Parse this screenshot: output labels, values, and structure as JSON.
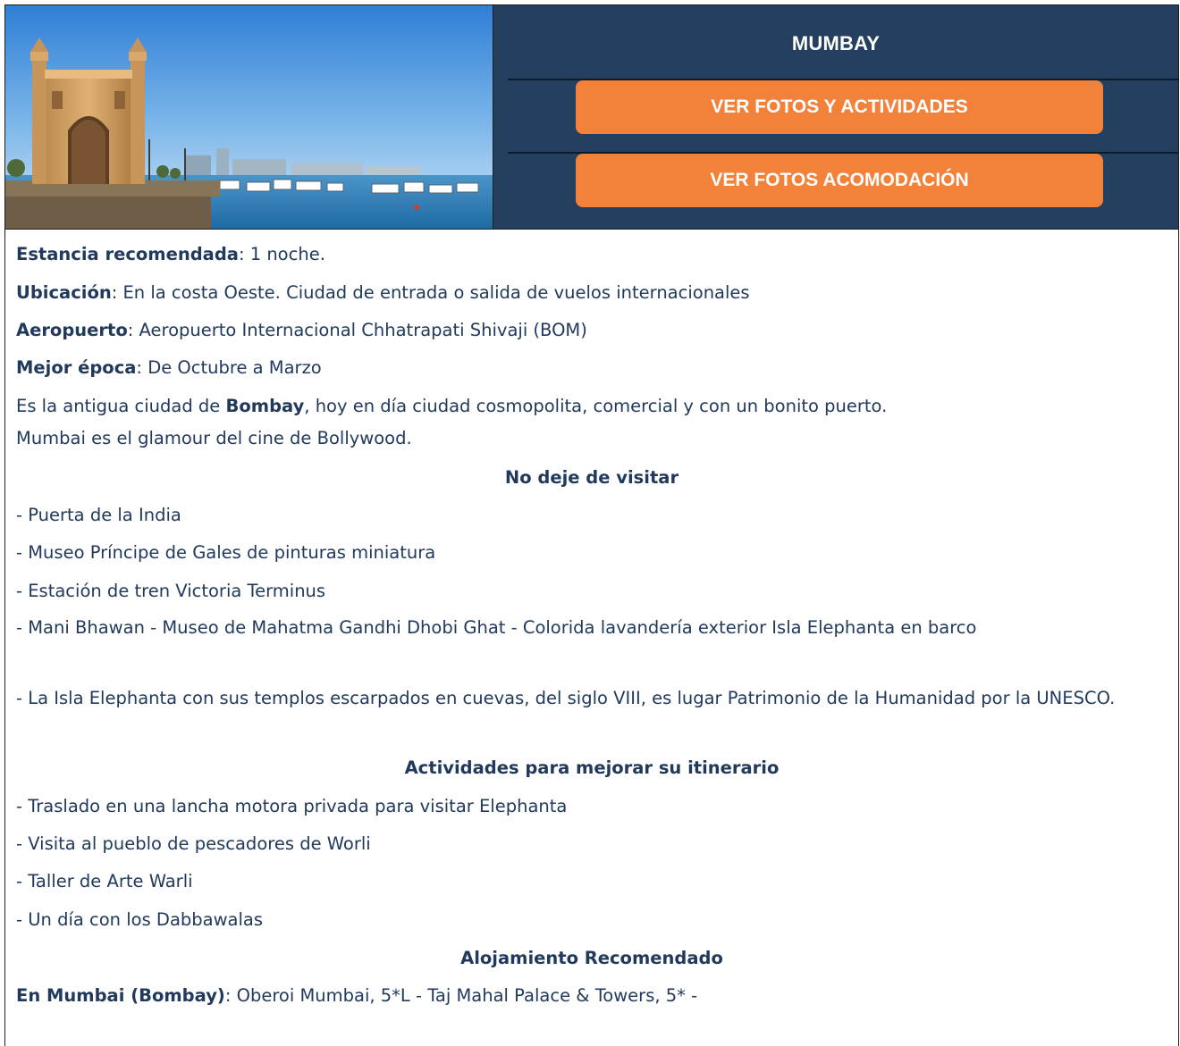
{
  "header": {
    "city": "MUMBAY",
    "buttons": {
      "activities": "VER FOTOS Y ACTIVIDADES",
      "accommodation": "VER FOTOS ACOMODACIÓN"
    }
  },
  "info": {
    "stay_label": "Estancia recomendada",
    "stay_value": ": 1 noche.",
    "location_label": "Ubicación",
    "location_value": ": En la costa Oeste. Ciudad de entrada o salida de vuelos internacionales",
    "airport_label": "Aeropuerto",
    "airport_value": ": Aeropuerto Internacional Chhatrapati Shivaji (BOM)",
    "season_label": "Mejor época",
    "season_value": ": De Octubre a Marzo",
    "desc_prefix": "Es la antigua ciudad de ",
    "desc_bold": "Bombay",
    "desc_suffix": ", hoy en día ciudad cosmopolita, comercial y con un bonito puerto.",
    "desc_line2": "Mumbai es el glamour del cine de Bollywood."
  },
  "visit": {
    "heading": "No deje de visitar",
    "items": [
      "- Puerta de la India",
      "- Museo Príncipe de Gales de pinturas miniatura",
      "- Estación de tren Victoria Terminus",
      "- Mani Bhawan - Museo de Mahatma Gandhi Dhobi Ghat - Colorida lavandería exterior Isla Elephanta en barco",
      "- La Isla Elephanta con sus templos escarpados en cuevas, del siglo VIII, es lugar Patrimonio de la Humanidad por la UNESCO."
    ]
  },
  "activities": {
    "heading": "Actividades para mejorar su itinerario",
    "items": [
      "- Traslado en una lancha motora privada para visitar Elephanta",
      "- Visita al pueblo de pescadores de Worli",
      "- Taller de Arte Warli",
      "- Un día con los Dabbawalas"
    ]
  },
  "lodging": {
    "heading": "Alojamiento Recomendado",
    "label": "En Mumbai (Bombay)",
    "value": ": Oberoi Mumbai, 5*L - Taj Mahal Palace & Towers, 5* -"
  },
  "colors": {
    "panel": "#25405e",
    "button": "#f2823a",
    "text": "#213a5c"
  }
}
